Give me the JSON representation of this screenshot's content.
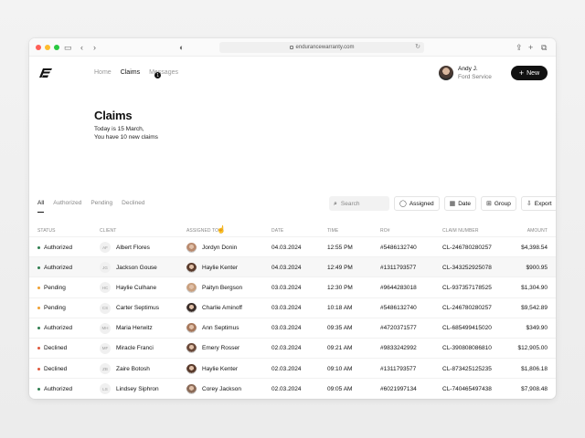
{
  "browser": {
    "url": "endurancewarranty.com"
  },
  "nav": {
    "home": "Home",
    "claims": "Claims",
    "messages": "Messages",
    "messages_badge": "1"
  },
  "user": {
    "name": "Andy J.",
    "company": "Ford Service"
  },
  "new_button": "New",
  "page": {
    "title": "Claims",
    "line1": "Today is 15 March,",
    "line2": "You have 10 new claims"
  },
  "filters": [
    "All",
    "Authorized",
    "Pending",
    "Declined"
  ],
  "search": {
    "placeholder": "Search"
  },
  "toolbar": {
    "assigned": "Assigned",
    "date": "Date",
    "group": "Group",
    "export": "Export"
  },
  "columns": {
    "status": "STATUS",
    "client": "CLIENT",
    "assigned": "ASSIGNED TO",
    "date": "DATE",
    "time": "TIME",
    "ro": "RO#",
    "claim": "CLAIM NUMBER",
    "amount": "AMOUNT"
  },
  "status_colors": {
    "Authorized": "#2e7d4f",
    "Pending": "#f0a030",
    "Declined": "#e0563b"
  },
  "rows": [
    {
      "status": "Authorized",
      "initials": "AF",
      "client": "Albert Flores",
      "assigned": "Jordyn Donin",
      "date": "04.03.2024",
      "time": "12:55 PM",
      "ro": "#5486132740",
      "claim": "CL-246780280257",
      "amount": "$4,398.54"
    },
    {
      "status": "Authorized",
      "initials": "JG",
      "client": "Jackson Gouse",
      "assigned": "Haylie Kenter",
      "date": "04.03.2024",
      "time": "12:49 PM",
      "ro": "#1311793577",
      "claim": "CL-343252925078",
      "amount": "$900.95"
    },
    {
      "status": "Pending",
      "initials": "HC",
      "client": "Haylie Culhane",
      "assigned": "Paityn Bergson",
      "date": "03.03.2024",
      "time": "12:30 PM",
      "ro": "#9644283018",
      "claim": "CL-937357178525",
      "amount": "$1,304.90"
    },
    {
      "status": "Pending",
      "initials": "CS",
      "client": "Carter Septimus",
      "assigned": "Charlie Aminoff",
      "date": "03.03.2024",
      "time": "10:18 AM",
      "ro": "#5486132740",
      "claim": "CL-246780280257",
      "amount": "$9,542.89"
    },
    {
      "status": "Authorized",
      "initials": "MH",
      "client": "Maria Herwitz",
      "assigned": "Ann Septimus",
      "date": "03.03.2024",
      "time": "09:35 AM",
      "ro": "#4720371577",
      "claim": "CL-685499415020",
      "amount": "$349.90"
    },
    {
      "status": "Declined",
      "initials": "MF",
      "client": "Miracle Franci",
      "assigned": "Emery Rosser",
      "date": "02.03.2024",
      "time": "09:21 AM",
      "ro": "#9833242992",
      "claim": "CL-390808086810",
      "amount": "$12,905.00"
    },
    {
      "status": "Declined",
      "initials": "ZB",
      "client": "Zaire Botosh",
      "assigned": "Haylie Kenter",
      "date": "02.03.2024",
      "time": "09:10 AM",
      "ro": "#1311793577",
      "claim": "CL-873425125235",
      "amount": "$1,806.18"
    },
    {
      "status": "Authorized",
      "initials": "LS",
      "client": "Lindsey Siphron",
      "assigned": "Corey Jackson",
      "date": "02.03.2024",
      "time": "09:05 AM",
      "ro": "#6021997134",
      "claim": "CL-740465497438",
      "amount": "$7,908.48"
    }
  ]
}
